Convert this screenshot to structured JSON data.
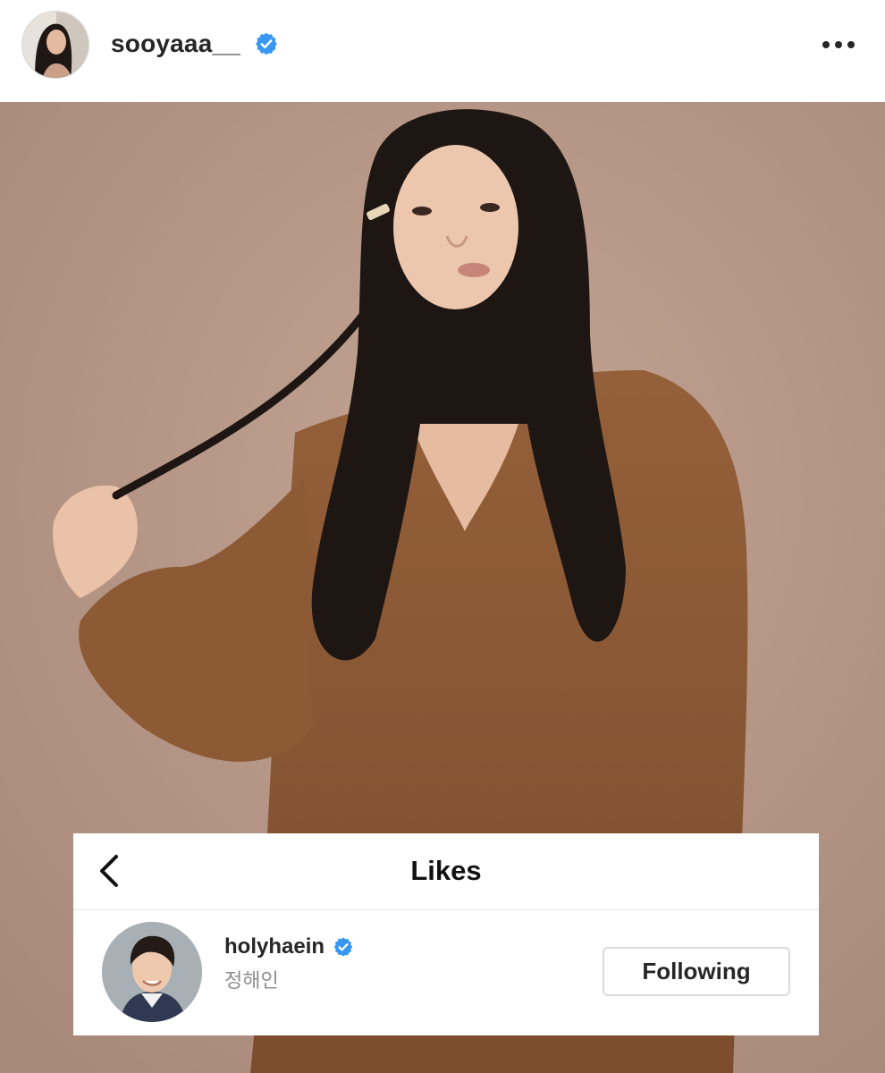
{
  "post": {
    "username": "sooyaaa__",
    "verified": true,
    "avatar": "profile-photo",
    "more_icon": "more-dots-icon",
    "photo": "portrait-photo"
  },
  "likes_panel": {
    "title": "Likes",
    "back_icon": "chevron-left-icon",
    "users": [
      {
        "username": "holyhaein",
        "full_name": "정해인",
        "verified": true,
        "button_label": "Following"
      }
    ]
  },
  "colors": {
    "verified_badge": "#3897f0",
    "photo_background": "#b49484",
    "sweater": "#8a5a36",
    "text_primary": "#262626",
    "text_secondary": "#8e8e8e"
  }
}
